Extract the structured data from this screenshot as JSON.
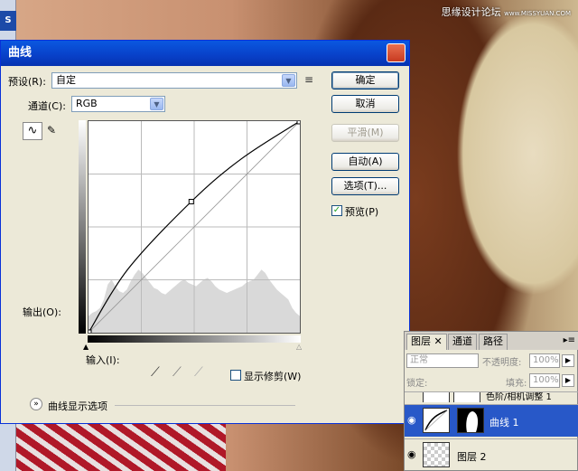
{
  "watermark": {
    "text": "思缘设计论坛",
    "url": "www.MISSYUAN.COM"
  },
  "left_strip": {
    "tab": "S"
  },
  "dialog": {
    "title": "曲线",
    "close_glyph": "✕",
    "preset_label": "预设(R):",
    "preset_value": "自定",
    "channel_label": "通道(C):",
    "channel_value": "RGB",
    "output_label": "输出(O):",
    "input_label": "输入(I):",
    "show_clipping_label": "显示修剪(W)",
    "show_clipping_checked": false,
    "display_options_label": "曲线显示选项",
    "preview_label": "预览(P)",
    "preview_checked": true,
    "buttons": {
      "ok": "确定",
      "cancel": "取消",
      "smooth": "平滑(M)",
      "auto": "自动(A)",
      "options": "选项(T)..."
    },
    "icons": {
      "curve_tool": "∿",
      "pencil_tool": "✎",
      "preset_menu": "≡",
      "expand": "»",
      "dropdown": "▼",
      "eyedropper": "⟋"
    }
  },
  "chart_data": {
    "type": "line",
    "title": "",
    "xlabel": "输入(I):",
    "ylabel": "输出(O):",
    "xlim": [
      0,
      255
    ],
    "ylim": [
      0,
      255
    ],
    "grid": true,
    "grid_divisions": 4,
    "series": [
      {
        "x": [
          0,
          48,
          124,
          185,
          255
        ],
        "y": [
          0,
          77,
          158,
          210,
          255
        ]
      },
      {
        "x": [
          0,
          255
        ],
        "y": [
          0,
          255
        ]
      }
    ],
    "control_point": {
      "x": 124,
      "y": 158
    },
    "histogram": [
      20,
      24,
      26,
      30,
      40,
      58,
      64,
      56,
      50,
      48,
      52,
      62,
      70,
      76,
      72,
      66,
      60,
      54,
      52,
      48,
      46,
      50,
      54,
      58,
      62,
      64,
      60,
      58,
      56,
      60,
      64,
      66,
      62,
      56,
      52,
      50,
      48,
      50,
      52,
      54,
      56,
      60,
      62,
      64,
      70,
      76,
      72,
      64,
      58,
      52,
      48,
      44,
      40,
      30,
      24,
      20
    ]
  },
  "layers_panel": {
    "tabs": [
      "图层",
      "通道",
      "路径"
    ],
    "tab_close": "✕",
    "menu_glyph": "▸≡",
    "blend_mode": "正常",
    "opacity_label": "不透明度:",
    "opacity_value": "100%",
    "lock_label": "锁定:",
    "fill_label": "填充:",
    "fill_value": "100%",
    "layers": [
      {
        "name": "色阶/相机调整 1"
      },
      {
        "name": "曲线 1",
        "selected": true
      },
      {
        "name": "图层 2"
      }
    ],
    "eye_glyph": "◉"
  }
}
